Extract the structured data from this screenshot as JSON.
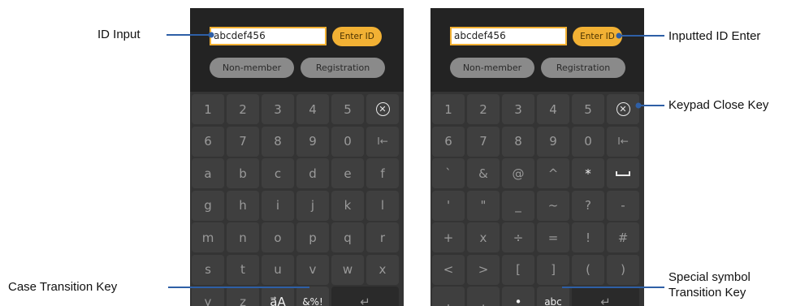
{
  "screens": [
    {
      "id_value": "abcdef456",
      "enter_label": "Enter ID",
      "nonmember_label": "Non-member",
      "registration_label": "Registration",
      "rows": [
        [
          "1",
          "2",
          "3",
          "4",
          "5",
          "⊗"
        ],
        [
          "6",
          "7",
          "8",
          "9",
          "0",
          "I←"
        ],
        [
          "a",
          "b",
          "c",
          "d",
          "e",
          "f"
        ],
        [
          "g",
          "h",
          "i",
          "j",
          "k",
          "l"
        ],
        [
          "m",
          "n",
          "o",
          "p",
          "q",
          "r"
        ],
        [
          "s",
          "t",
          "u",
          "v",
          "w",
          "x"
        ],
        [
          "y",
          "z",
          "a⃗A",
          "&%!",
          "↵"
        ]
      ]
    },
    {
      "id_value": "abcdef456",
      "enter_label": "Enter ID",
      "nonmember_label": "Non-member",
      "registration_label": "Registration",
      "rows": [
        [
          "1",
          "2",
          "3",
          "4",
          "5",
          "⊗"
        ],
        [
          "6",
          "7",
          "8",
          "9",
          "0",
          "I←"
        ],
        [
          "`",
          "&",
          "@",
          "^",
          "*",
          "space"
        ],
        [
          "'",
          "\"",
          "_",
          "~",
          "?",
          "-"
        ],
        [
          "+",
          "x",
          "÷",
          "=",
          "!",
          "#"
        ],
        [
          "<",
          ">",
          "[",
          "]",
          "(",
          ")"
        ],
        [
          ".",
          ",",
          "•",
          "abc",
          "↵"
        ]
      ]
    }
  ],
  "callouts": {
    "id_input": "ID Input",
    "inputted_id_enter": "Inputted ID Enter",
    "keypad_close_key": "Keypad Close Key",
    "case_transition_key": "Case Transition Key",
    "special_symbol_line1": "Special symbol",
    "special_symbol_line2": "Transition Key"
  },
  "colors": {
    "accent": "#f2b134",
    "connector": "#2e5fa6"
  }
}
